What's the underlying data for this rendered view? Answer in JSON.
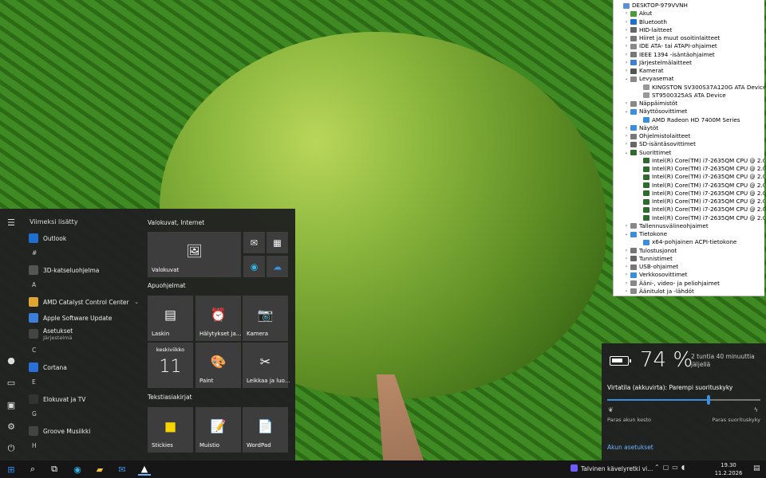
{
  "device_manager": {
    "rows": [
      {
        "level": 0,
        "arrow": "",
        "label": "DESKTOP-979VVNH",
        "color": "#5b8fd6"
      },
      {
        "level": 1,
        "arrow": "›",
        "label": "Akut",
        "color": "#4a9a3c"
      },
      {
        "level": 1,
        "arrow": "›",
        "label": "Bluetooth",
        "color": "#1f6fd1"
      },
      {
        "level": 1,
        "arrow": "›",
        "label": "HID-laitteet",
        "color": "#666"
      },
      {
        "level": 1,
        "arrow": "›",
        "label": "Hiiret ja muut osoitinlaitteet",
        "color": "#777"
      },
      {
        "level": 1,
        "arrow": "›",
        "label": "IDE ATA- tai ATAPI-ohjaimet",
        "color": "#888"
      },
      {
        "level": 1,
        "arrow": "›",
        "label": "IEEE 1394 -isäntäohjaimet",
        "color": "#777"
      },
      {
        "level": 1,
        "arrow": "›",
        "label": "Järjestelmälaitteet",
        "color": "#3f7fcf"
      },
      {
        "level": 1,
        "arrow": "›",
        "label": "Kamerat",
        "color": "#555"
      },
      {
        "level": 1,
        "arrow": "⌄",
        "label": "Levyasemat",
        "color": "#888"
      },
      {
        "level": 2,
        "arrow": "",
        "label": "KINGSTON SV300S37A120G ATA Device",
        "color": "#999"
      },
      {
        "level": 2,
        "arrow": "",
        "label": "ST9500325AS ATA Device",
        "color": "#999"
      },
      {
        "level": 1,
        "arrow": "›",
        "label": "Näppäimistöt",
        "color": "#888"
      },
      {
        "level": 1,
        "arrow": "⌄",
        "label": "Näyttösovittimet",
        "color": "#3a8fd8"
      },
      {
        "level": 2,
        "arrow": "",
        "label": "AMD Radeon HD 7400M Series",
        "color": "#3a8fd8"
      },
      {
        "level": 1,
        "arrow": "›",
        "label": "Näytöt",
        "color": "#3a8fd8"
      },
      {
        "level": 1,
        "arrow": "›",
        "label": "Ohjelmistolaitteet",
        "color": "#777"
      },
      {
        "level": 1,
        "arrow": "›",
        "label": "SD-isäntäsovittimet",
        "color": "#666"
      },
      {
        "level": 1,
        "arrow": "⌄",
        "label": "Suorittimet",
        "color": "#2f6b2f"
      },
      {
        "level": 2,
        "arrow": "",
        "label": "Intel(R) Core(TM) i7-2635QM CPU @ 2.00GHz",
        "color": "#2f6b2f"
      },
      {
        "level": 2,
        "arrow": "",
        "label": "Intel(R) Core(TM) i7-2635QM CPU @ 2.00GHz",
        "color": "#2f6b2f"
      },
      {
        "level": 2,
        "arrow": "",
        "label": "Intel(R) Core(TM) i7-2635QM CPU @ 2.00GHz",
        "color": "#2f6b2f"
      },
      {
        "level": 2,
        "arrow": "",
        "label": "Intel(R) Core(TM) i7-2635QM CPU @ 2.00GHz",
        "color": "#2f6b2f"
      },
      {
        "level": 2,
        "arrow": "",
        "label": "Intel(R) Core(TM) i7-2635QM CPU @ 2.00GHz",
        "color": "#2f6b2f"
      },
      {
        "level": 2,
        "arrow": "",
        "label": "Intel(R) Core(TM) i7-2635QM CPU @ 2.00GHz",
        "color": "#2f6b2f"
      },
      {
        "level": 2,
        "arrow": "",
        "label": "Intel(R) Core(TM) i7-2635QM CPU @ 2.00GHz",
        "color": "#2f6b2f"
      },
      {
        "level": 2,
        "arrow": "",
        "label": "Intel(R) Core(TM) i7-2635QM CPU @ 2.00GHz",
        "color": "#2f6b2f"
      },
      {
        "level": 1,
        "arrow": "›",
        "label": "Tallennusvälineohjaimet",
        "color": "#888"
      },
      {
        "level": 1,
        "arrow": "⌄",
        "label": "Tietokone",
        "color": "#3a8fd8"
      },
      {
        "level": 2,
        "arrow": "",
        "label": "x64-pohjainen ACPI-tietokone",
        "color": "#3a8fd8"
      },
      {
        "level": 1,
        "arrow": "›",
        "label": "Tulostusjonot",
        "color": "#777"
      },
      {
        "level": 1,
        "arrow": "›",
        "label": "Tunnistimet",
        "color": "#666"
      },
      {
        "level": 1,
        "arrow": "›",
        "label": "USB-ohjaimet",
        "color": "#777"
      },
      {
        "level": 1,
        "arrow": "›",
        "label": "Verkkosovittimet",
        "color": "#3a8fd8"
      },
      {
        "level": 1,
        "arrow": "›",
        "label": "Ääni-, video- ja peliohjaimet",
        "color": "#888"
      },
      {
        "level": 1,
        "arrow": "›",
        "label": "Äänitulot ja -lähdöt",
        "color": "#888"
      }
    ]
  },
  "start_menu": {
    "recent_header": "Viimeksi lisätty",
    "apps": [
      {
        "kind": "item",
        "label": "Outlook",
        "sub": "",
        "color": "#1f6fd1",
        "chev": ""
      },
      {
        "kind": "letter",
        "label": "#"
      },
      {
        "kind": "item",
        "label": "3D-katseluohjelma",
        "sub": "",
        "color": "#555",
        "chev": ""
      },
      {
        "kind": "letter",
        "label": "A"
      },
      {
        "kind": "item",
        "label": "AMD Catalyst Control Center",
        "sub": "",
        "color": "#e0a530",
        "chev": "⌄"
      },
      {
        "kind": "item",
        "label": "Apple Software Update",
        "sub": "",
        "color": "#3b7fd8",
        "chev": ""
      },
      {
        "kind": "item",
        "label": "Asetukset",
        "sub": "Järjestelmä",
        "color": "#444",
        "chev": ""
      },
      {
        "kind": "letter",
        "label": "C"
      },
      {
        "kind": "item",
        "label": "Cortana",
        "sub": "",
        "color": "#2b6fd6",
        "chev": ""
      },
      {
        "kind": "letter",
        "label": "E"
      },
      {
        "kind": "item",
        "label": "Elokuvat ja TV",
        "sub": "",
        "color": "#333",
        "chev": ""
      },
      {
        "kind": "letter",
        "label": "G"
      },
      {
        "kind": "item",
        "label": "Groove Musiikki",
        "sub": "",
        "color": "#444",
        "chev": ""
      },
      {
        "kind": "letter",
        "label": "H"
      }
    ],
    "groups": {
      "group1": "Valokuvat, Internet",
      "group2": "Apuohjelmat",
      "group3": "Tekstiasiakirjat"
    },
    "tiles": {
      "photos": "Valokuvat",
      "calculator": "Laskin",
      "alarms": "Hälytykset ja...",
      "camera": "Kamera",
      "calendar_day": "keskiviikko",
      "calendar_date": "11",
      "paint": "Paint",
      "snip": "Leikkaa ja luo...",
      "stickies": "Stickies",
      "notepad": "Muistio",
      "wordpad": "WordPad"
    }
  },
  "battery": {
    "percent": "74 %",
    "level": 0.74,
    "remaining": "2 tuntia 40 minuuttia jäljellä",
    "mode": "Virtatila (akkuvirta): Parempi suorituskyky",
    "slider_position": 0.66,
    "left_label": "Paras akun kesto",
    "right_label": "Paras suorituskyky",
    "settings_link": "Akun asetukset"
  },
  "taskbar": {
    "media_text": "Talvinen kävelyretki vi...",
    "time": "19.30",
    "date": "11.2.2026"
  }
}
